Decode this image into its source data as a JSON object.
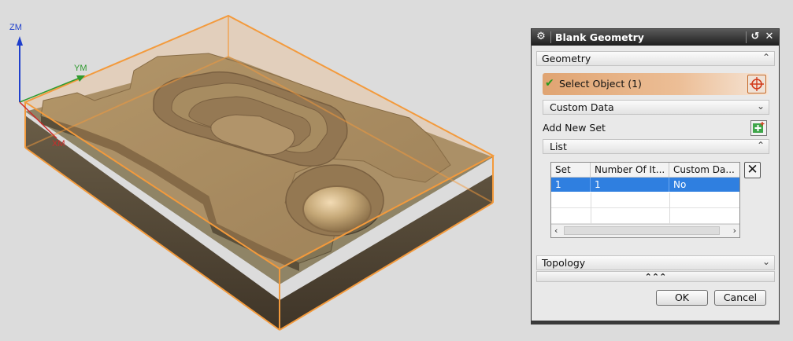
{
  "viewport": {
    "axis_z": "ZM",
    "axis_y": "YM",
    "axis_x": "XM",
    "colors": {
      "background": "#dcdcdc",
      "box": "#f39a3c",
      "part_top": "#8a7d5c",
      "part_side": "#5c5040",
      "axis_z": "#1f3fcc",
      "axis_y": "#2f9a2f",
      "axis_x": "#cc2a2a"
    }
  },
  "dialog": {
    "title": "Blank Geometry",
    "icons": {
      "menu": "gear-icon",
      "reset": "reset-icon",
      "close": "close-icon"
    },
    "geometry": {
      "section_label": "Geometry",
      "select_label": "Select Object (1)",
      "select_icon": "crosshair-icon"
    },
    "custom_data": {
      "section_label": "Custom Data"
    },
    "add_new_set": {
      "label": "Add New Set",
      "icon": "add-set-icon"
    },
    "list": {
      "section_label": "List",
      "columns": [
        "Set",
        "Number Of It...",
        "Custom Da..."
      ],
      "rows": [
        [
          "1",
          "1",
          "No"
        ]
      ],
      "delete_icon": "delete-icon"
    },
    "topology": {
      "section_label": "Topology",
      "more_glyph": "⌃⌃⌃"
    },
    "buttons": {
      "ok": "OK",
      "cancel": "Cancel"
    }
  }
}
